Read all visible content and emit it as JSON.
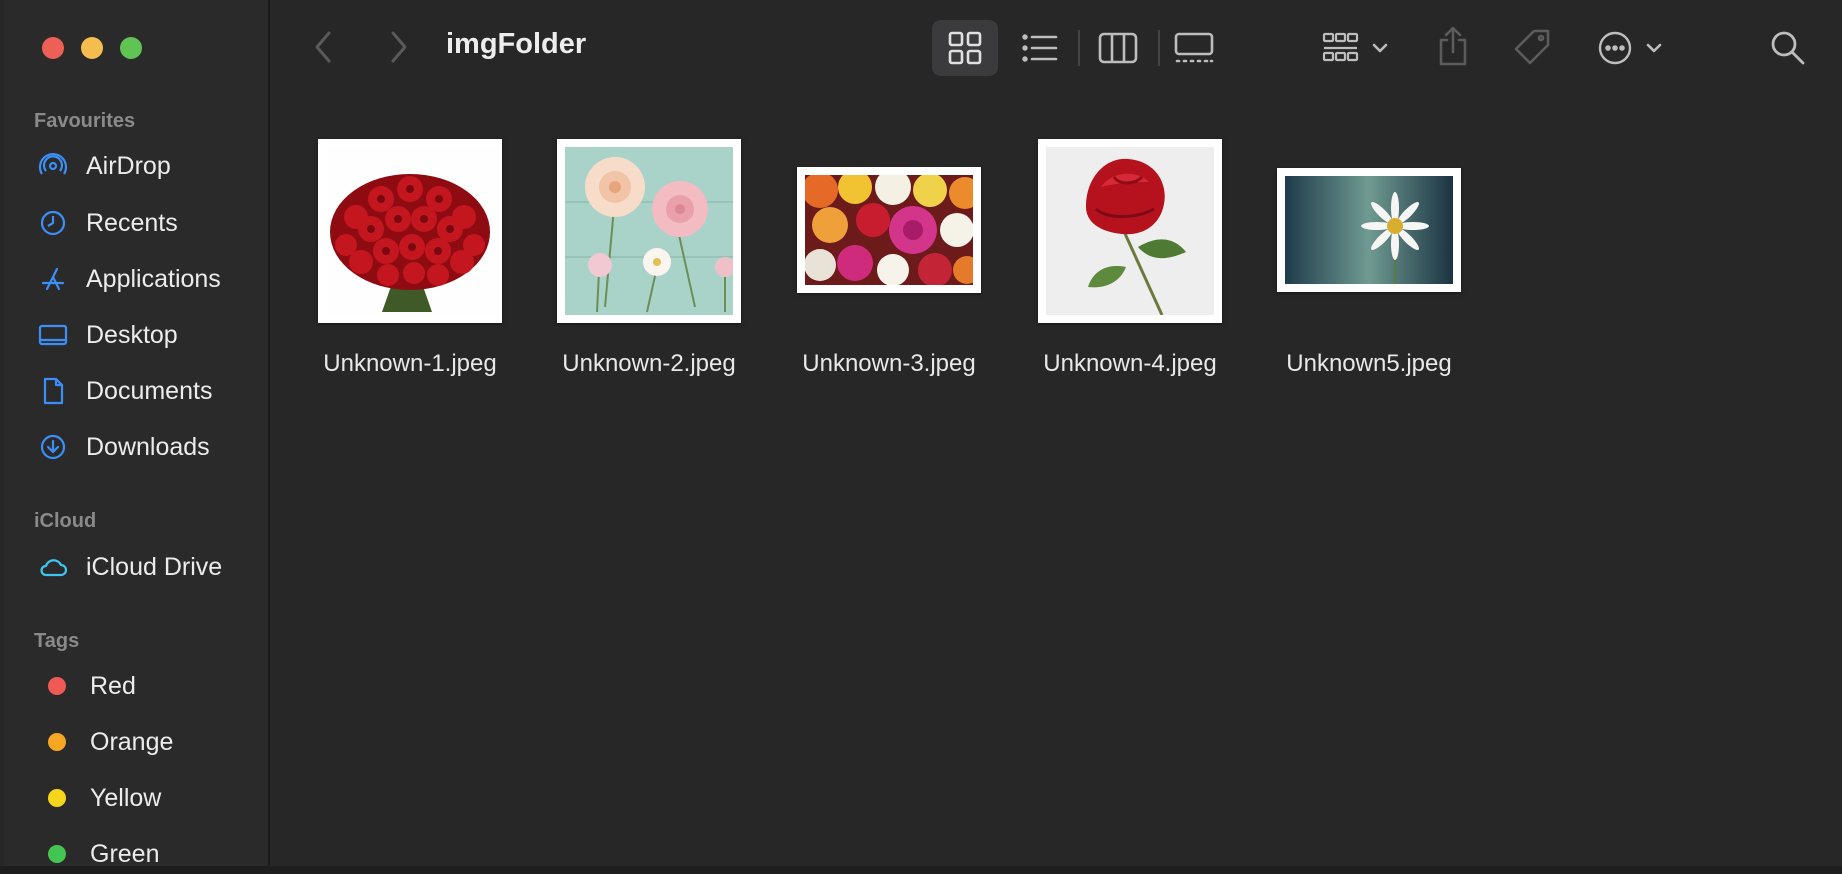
{
  "window": {
    "title": "imgFolder"
  },
  "traffic_lights": {
    "close": "#ee5f57",
    "minimize": "#f5bd4f",
    "zoom": "#5fc453"
  },
  "sidebar": {
    "favourites_label": "Favourites",
    "favourites": [
      {
        "label": "AirDrop",
        "icon": "airdrop-icon"
      },
      {
        "label": "Recents",
        "icon": "clock-icon"
      },
      {
        "label": "Applications",
        "icon": "applications-icon"
      },
      {
        "label": "Desktop",
        "icon": "desktop-icon"
      },
      {
        "label": "Documents",
        "icon": "document-icon"
      },
      {
        "label": "Downloads",
        "icon": "download-icon"
      }
    ],
    "icloud_label": "iCloud",
    "icloud": [
      {
        "label": "iCloud Drive",
        "icon": "cloud-icon"
      }
    ],
    "tags_label": "Tags",
    "tags": [
      {
        "label": "Red",
        "color": "#ef5a55"
      },
      {
        "label": "Orange",
        "color": "#f5a623"
      },
      {
        "label": "Yellow",
        "color": "#f7d51d"
      },
      {
        "label": "Green",
        "color": "#44c552"
      }
    ]
  },
  "toolbar": {
    "icons": [
      "back-icon",
      "forward-icon",
      "icon-view-icon",
      "list-view-icon",
      "column-view-icon",
      "gallery-view-icon",
      "group-icon",
      "share-icon",
      "tag-icon",
      "more-icon",
      "search-icon"
    ],
    "selected_view": "icon-view"
  },
  "files": [
    {
      "name": "Unknown-1.jpeg",
      "subject": "red rose bouquet"
    },
    {
      "name": "Unknown-2.jpeg",
      "subject": "pink dahlias"
    },
    {
      "name": "Unknown-3.jpeg",
      "subject": "colorful roses"
    },
    {
      "name": "Unknown-4.jpeg",
      "subject": "single red rose"
    },
    {
      "name": "Unknown5.jpeg",
      "subject": "white daisy"
    }
  ],
  "colors": {
    "accent_icon": "#3b8ff7",
    "background": "#272727",
    "sidebar": "#2a2a2b"
  }
}
